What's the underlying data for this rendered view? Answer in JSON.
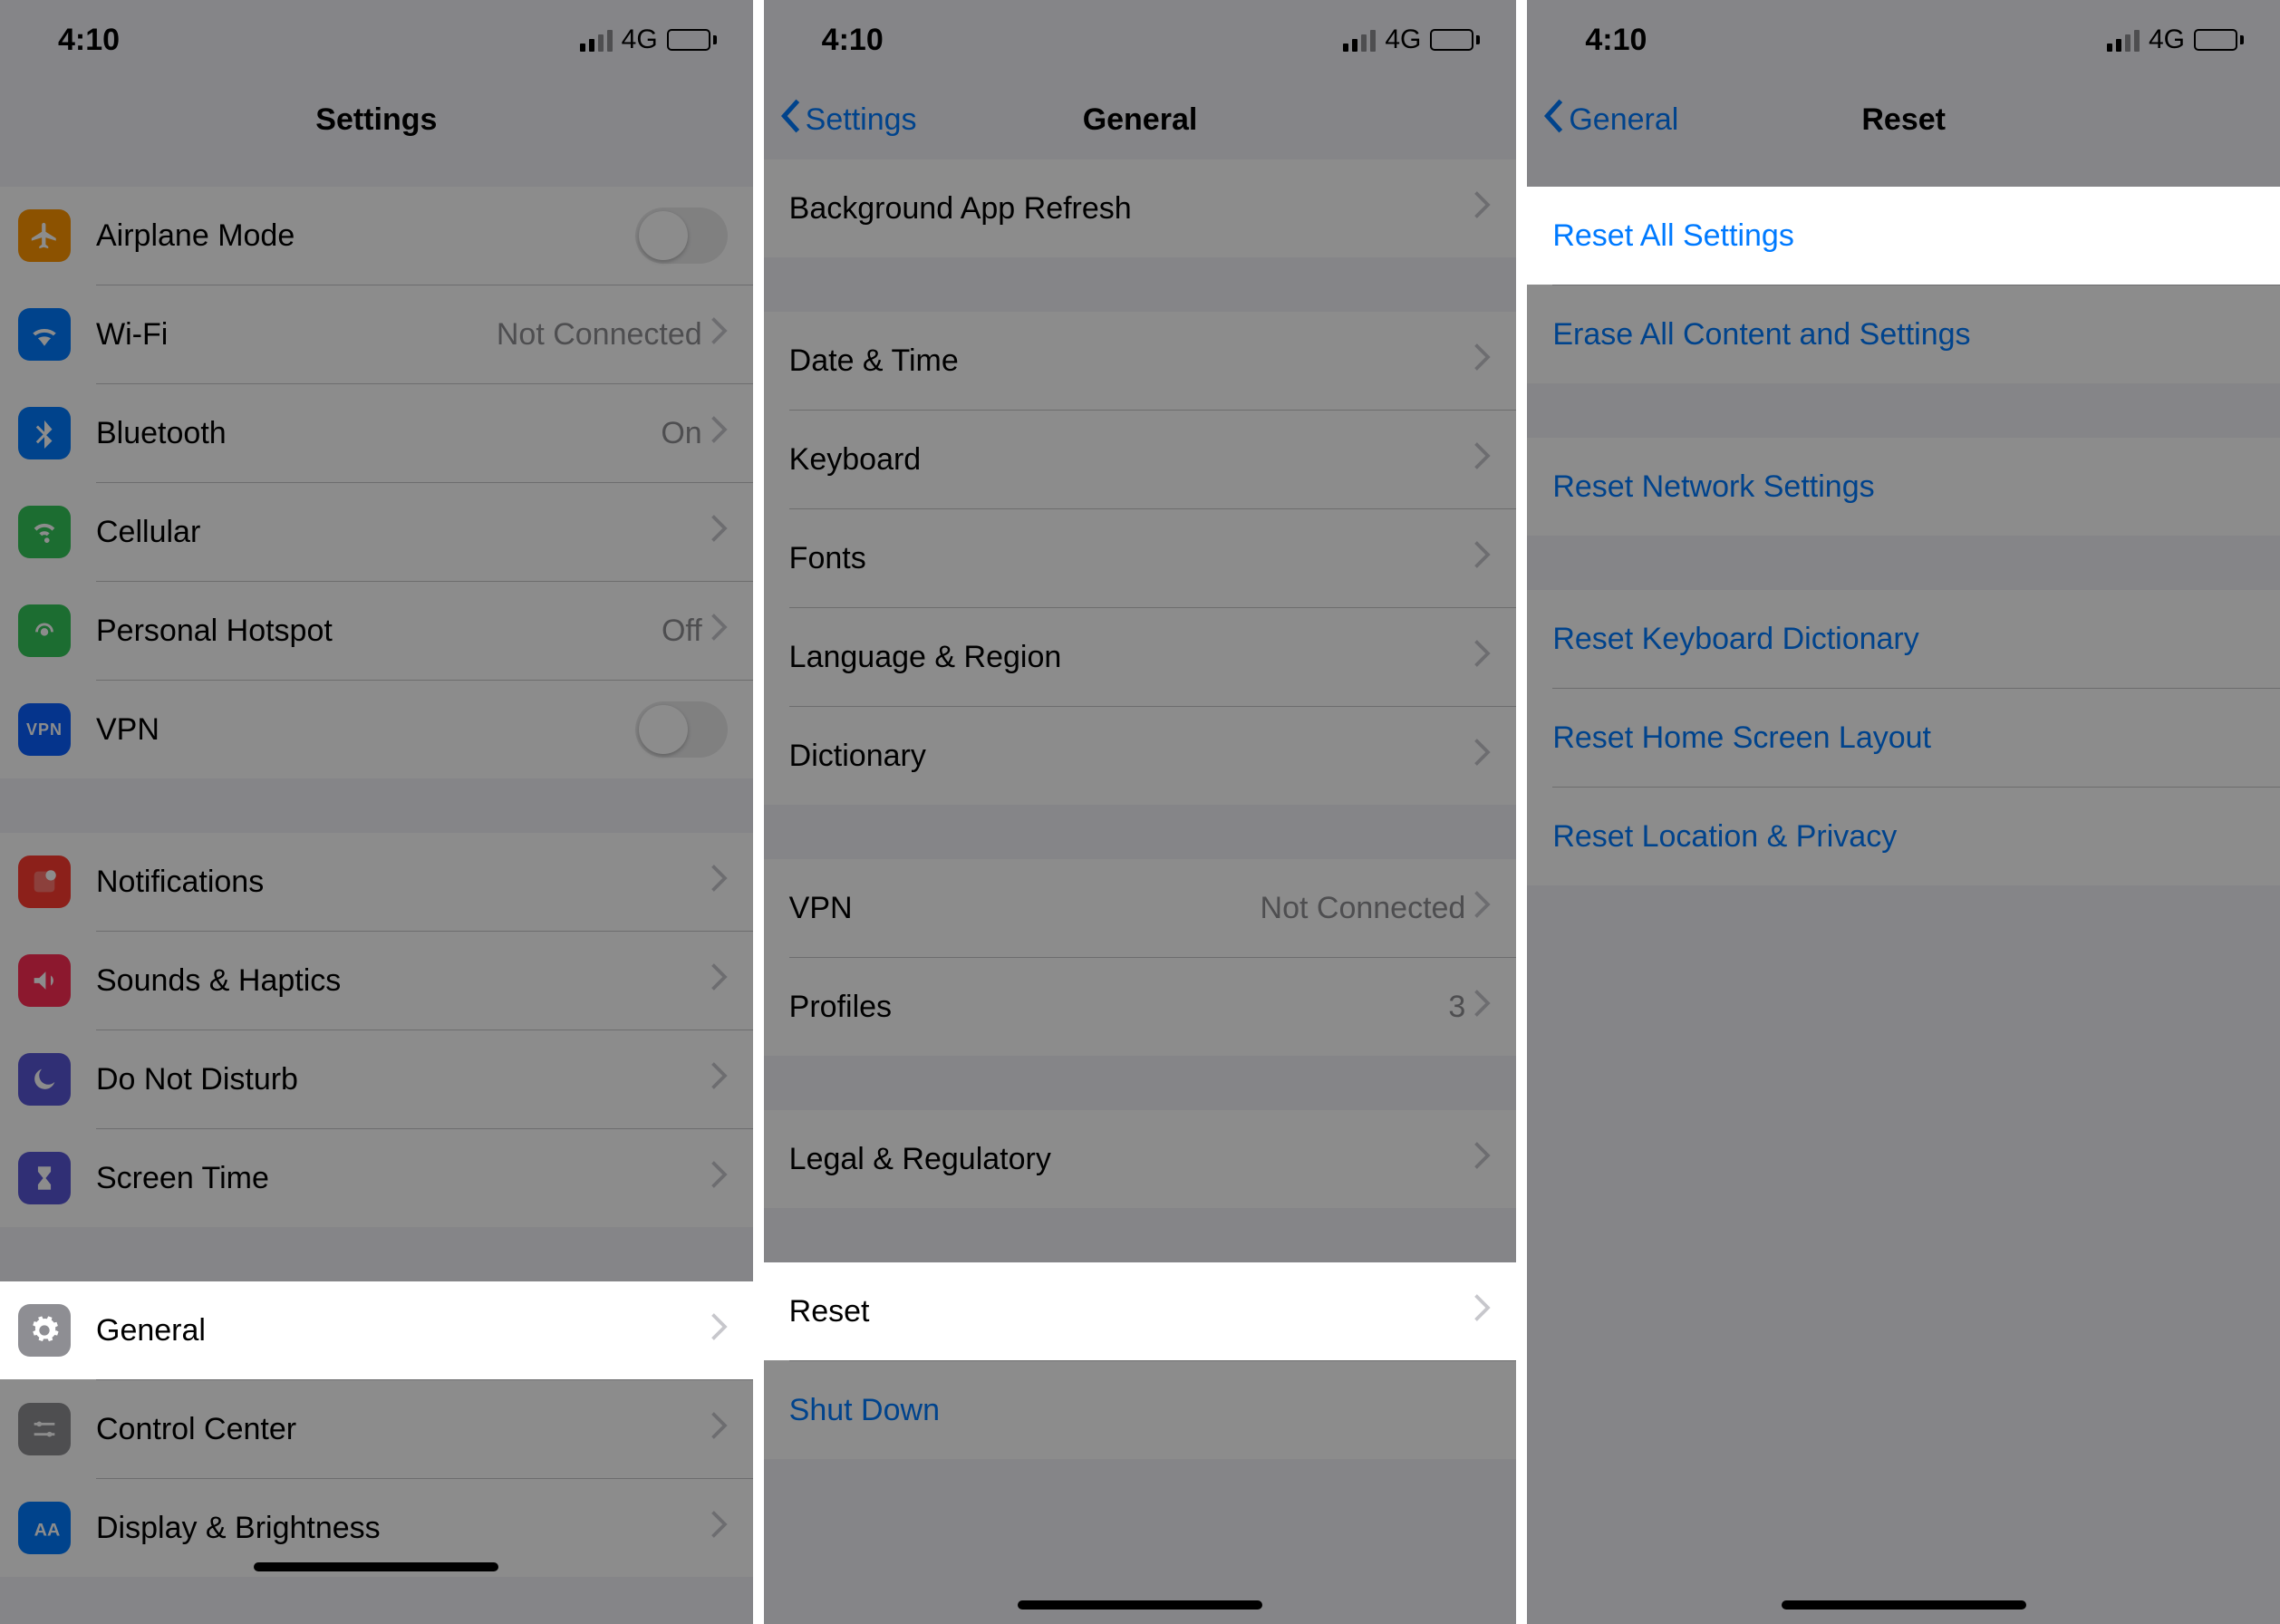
{
  "status": {
    "time": "4:10",
    "network": "4G"
  },
  "panel1": {
    "title": "Settings",
    "rows": {
      "airplane": "Airplane Mode",
      "wifi": "Wi-Fi",
      "wifi_detail": "Not Connected",
      "bluetooth": "Bluetooth",
      "bluetooth_detail": "On",
      "cellular": "Cellular",
      "hotspot": "Personal Hotspot",
      "hotspot_detail": "Off",
      "vpn": "VPN",
      "notifications": "Notifications",
      "sounds": "Sounds & Haptics",
      "dnd": "Do Not Disturb",
      "screentime": "Screen Time",
      "general": "General",
      "controlcenter": "Control Center",
      "display": "Display & Brightness"
    }
  },
  "panel2": {
    "back": "Settings",
    "title": "General",
    "rows": {
      "bgrefresh": "Background App Refresh",
      "datetime": "Date & Time",
      "keyboard": "Keyboard",
      "fonts": "Fonts",
      "lang": "Language & Region",
      "dictionary": "Dictionary",
      "vpn": "VPN",
      "vpn_detail": "Not Connected",
      "profiles": "Profiles",
      "profiles_detail": "3",
      "legal": "Legal & Regulatory",
      "reset": "Reset",
      "shutdown": "Shut Down"
    }
  },
  "panel3": {
    "back": "General",
    "title": "Reset",
    "rows": {
      "reset_all": "Reset All Settings",
      "erase": "Erase All Content and Settings",
      "network": "Reset Network Settings",
      "kbdict": "Reset Keyboard Dictionary",
      "home": "Reset Home Screen Layout",
      "location": "Reset Location & Privacy"
    }
  }
}
